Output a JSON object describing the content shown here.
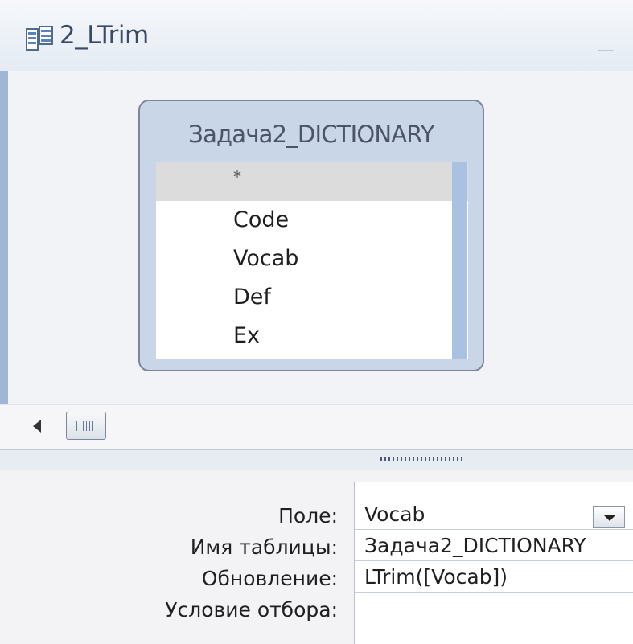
{
  "window": {
    "title": "2_LTrim",
    "icon": "query-icon",
    "minimize_label": "_"
  },
  "table": {
    "title": "Задача2_DICTIONARY",
    "fields": [
      "*",
      "Code",
      "Vocab",
      "Def",
      "Ex"
    ],
    "selected_index": 0
  },
  "grid": {
    "labels": {
      "field": "Поле:",
      "table_name": "Имя таблицы:",
      "update": "Обновление:",
      "criteria": "Условие отбора:"
    },
    "column": {
      "field": "Vocab",
      "table_name": "Задача2_DICTIONARY",
      "update": "LTrim([Vocab])",
      "criteria": ""
    }
  },
  "colors": {
    "accent": "#9fb6d6",
    "table_border": "#7d8798"
  }
}
